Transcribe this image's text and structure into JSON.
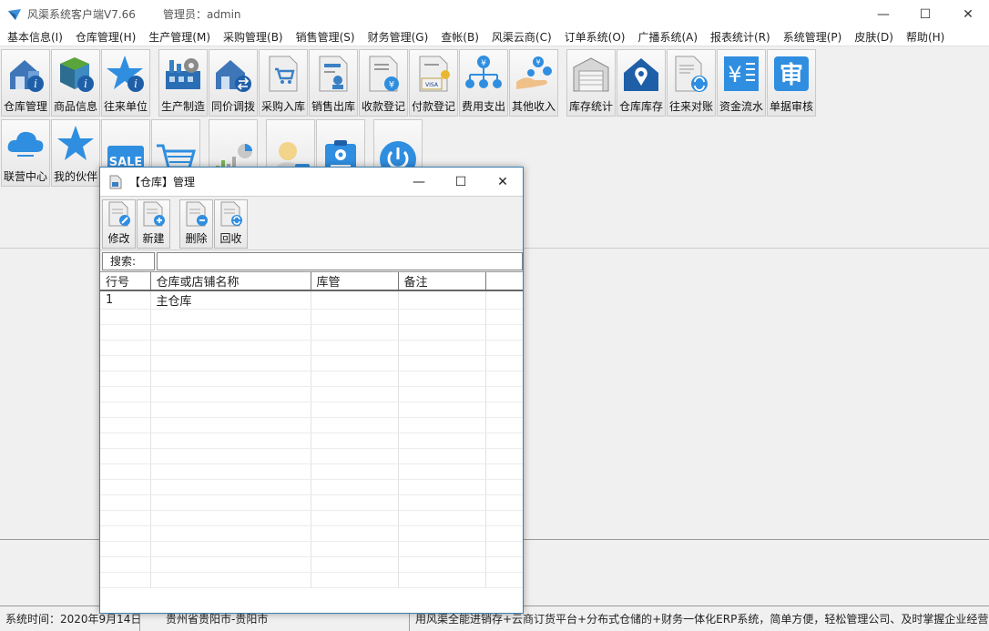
{
  "window": {
    "title": "风渠系统客户端V7.66",
    "admin_label": "管理员：admin",
    "minimize": "—",
    "maximize": "☐",
    "close": "✕"
  },
  "menu": [
    "基本信息(I)",
    "仓库管理(H)",
    "生产管理(M)",
    "采购管理(B)",
    "销售管理(S)",
    "财务管理(G)",
    "查帐(B)",
    "风渠云商(C)",
    "订单系统(O)",
    "广播系统(A)",
    "报表统计(R)",
    "系统管理(P)",
    "皮肤(D)",
    "帮助(H)"
  ],
  "toolbar": {
    "row1": [
      {
        "label": "仓库管理",
        "icon": "warehouse-info-icon"
      },
      {
        "label": "商品信息",
        "icon": "product-box-icon"
      },
      {
        "label": "往来单位",
        "icon": "star-info-icon"
      },
      {
        "label": "生产制造",
        "icon": "factory-gear-icon"
      },
      {
        "label": "同价调拨",
        "icon": "transfer-house-icon"
      },
      {
        "label": "采购入库",
        "icon": "cart-document-icon"
      },
      {
        "label": "销售出库",
        "icon": "sales-document-icon"
      },
      {
        "label": "收款登记",
        "icon": "yen-document-icon"
      },
      {
        "label": "付款登记",
        "icon": "visa-document-icon"
      },
      {
        "label": "费用支出",
        "icon": "yen-tree-icon"
      },
      {
        "label": "其他收入",
        "icon": "hand-coins-icon"
      },
      {
        "label": "库存统计",
        "icon": "garage-icon"
      },
      {
        "label": "仓库库存",
        "icon": "house-location-icon"
      },
      {
        "label": "往来对账",
        "icon": "reconcile-document-icon"
      },
      {
        "label": "资金流水",
        "icon": "yen-ledger-icon"
      },
      {
        "label": "单据审核",
        "icon": "audit-stamp-icon"
      }
    ],
    "row2": [
      {
        "label": "联营中心",
        "icon": "cloud-icon"
      },
      {
        "label": "我的伙伴",
        "icon": "star-icon"
      },
      {
        "label": "",
        "icon": "sale-tag-icon"
      },
      {
        "label": "",
        "icon": "shopping-cart-icon"
      },
      {
        "label": "",
        "icon": "bar-chart-icon"
      },
      {
        "label": "",
        "icon": "user-profile-icon"
      },
      {
        "label": "",
        "icon": "settings-clipboard-icon"
      },
      {
        "label": "",
        "icon": "power-icon"
      }
    ]
  },
  "dialog": {
    "title": "【仓库】管理",
    "minimize": "—",
    "maximize": "☐",
    "close": "✕",
    "buttons": [
      {
        "label": "修改",
        "icon": "edit-document-icon"
      },
      {
        "label": "新建",
        "icon": "add-document-icon"
      },
      {
        "label": "删除",
        "icon": "delete-document-icon"
      },
      {
        "label": "回收",
        "icon": "recycle-document-icon"
      }
    ],
    "search_label": "搜索:",
    "search_value": "",
    "columns": [
      "行号",
      "仓库或店铺名称",
      "库管",
      "备注",
      ""
    ],
    "rows": [
      [
        "1",
        "主仓库",
        "",
        "",
        ""
      ]
    ]
  },
  "status": {
    "time": "系统时间：2020年9月14日",
    "location": "贵州省贵阳市-贵阳市",
    "marquee": "用风渠全能进销存+云商订货平台+分布式仓储的+财务一体化ERP系统，简单方便，轻松管理公司、及时掌握企业经营"
  }
}
